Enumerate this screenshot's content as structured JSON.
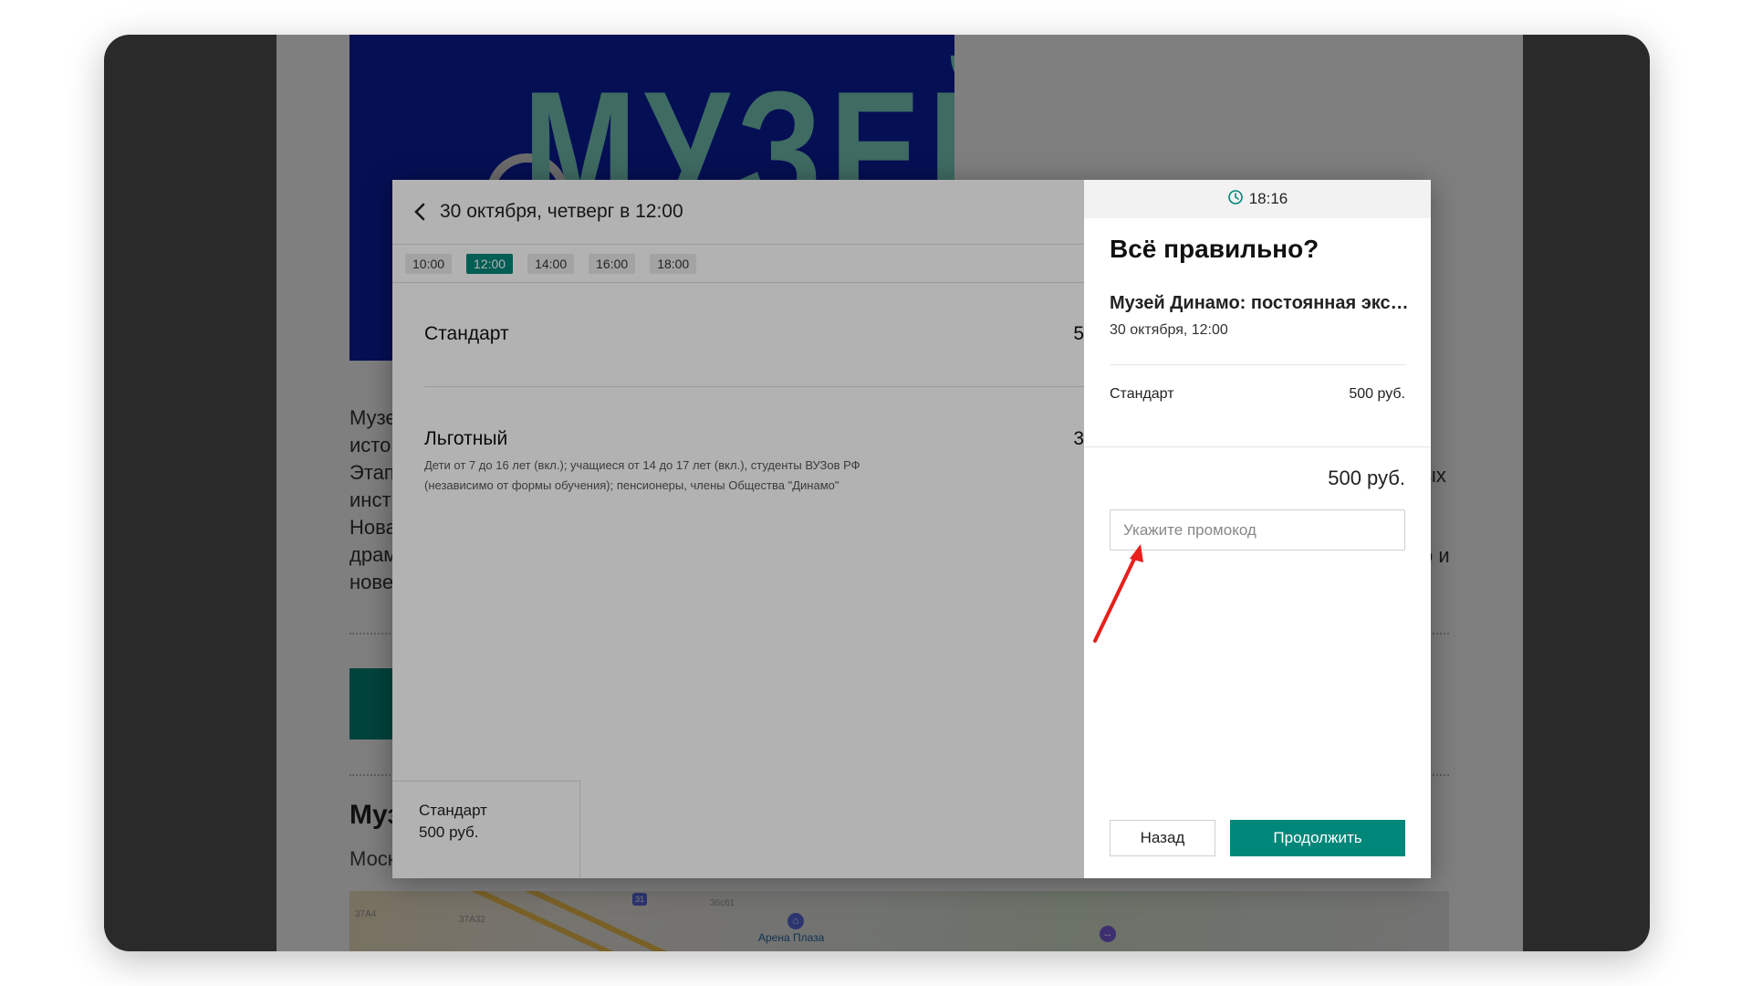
{
  "background": {
    "hero_title": "МУЗЕЙ",
    "text_lines": [
      "Музе",
      "исто",
      "Этап",
      "инст",
      "Нова",
      "драм",
      "нове"
    ],
    "text_right_1": "ых",
    "text_right_2": "о и",
    "heading": "Муз",
    "subheading": "Моск",
    "map": {
      "labels": [
        "Арена Плаза"
      ],
      "small_labels": [
        "37А4",
        "37А32",
        "36с61"
      ],
      "badge": "31"
    }
  },
  "left_panel": {
    "date_title": "30 октября, четверг в 12:00",
    "times": [
      "10:00",
      "12:00",
      "14:00",
      "16:00",
      "18:00"
    ],
    "active_time": "12:00",
    "tickets": [
      {
        "name": "Стандарт",
        "cut_char": "5",
        "description": ""
      },
      {
        "name": "Льготный",
        "cut_char": "3",
        "description_line1": "Дети от 7 до 16 лет (вкл.); учащиеся от 14 до 17 лет (вкл.), студенты ВУЗов РФ",
        "description_line2": "(независимо от формы обучения); пенсионеры, члены Общества \"Динамо\""
      }
    ],
    "summary": {
      "name": "Стандарт",
      "price": "500 руб."
    }
  },
  "right_panel": {
    "timer": "18:16",
    "title": "Всё правильно?",
    "event_name": "Музей Динамо: постоянная экспозиция",
    "event_when": "30 октября, 12:00",
    "line_item": {
      "name": "Стандарт",
      "price": "500 руб."
    },
    "total": "500 руб.",
    "promo_placeholder": "Укажите промокод",
    "back_label": "Назад",
    "continue_label": "Продолжить"
  },
  "colors": {
    "accent": "#00877a",
    "annotation_arrow": "#e8201c",
    "hero_bg": "#0a1ea8"
  },
  "icons": [
    "chevron-left-icon",
    "clock-icon",
    "annotation-arrow-icon",
    "metro-icon",
    "place-pin-icon"
  ]
}
